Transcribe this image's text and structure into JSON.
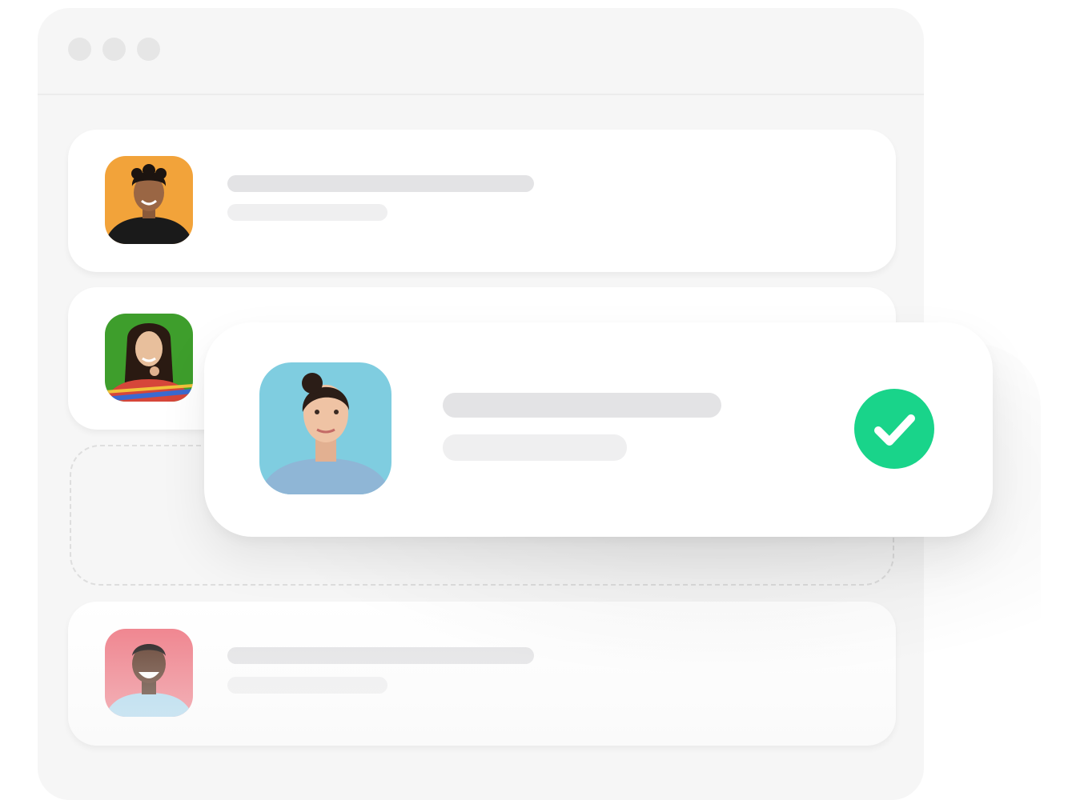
{
  "window": {
    "controls": [
      "close-dot",
      "minimize-dot",
      "maximize-dot"
    ],
    "control_color": "#e6e6e6"
  },
  "list": {
    "items": [
      {
        "avatar_icon": "person-avatar-orange",
        "avatar_bg": "#f2a33a"
      },
      {
        "avatar_icon": "person-avatar-green",
        "avatar_bg": "#3e9e2c"
      },
      {
        "avatar_icon": "person-avatar-pink",
        "avatar_bg": "#ef7a85"
      }
    ],
    "placeholder_color": "#e3e3e5"
  },
  "dragged_card": {
    "avatar_icon": "person-avatar-blue",
    "avatar_bg": "#7fcde0",
    "status_icon": "check-circle-icon",
    "status_color": "#19d48a"
  }
}
